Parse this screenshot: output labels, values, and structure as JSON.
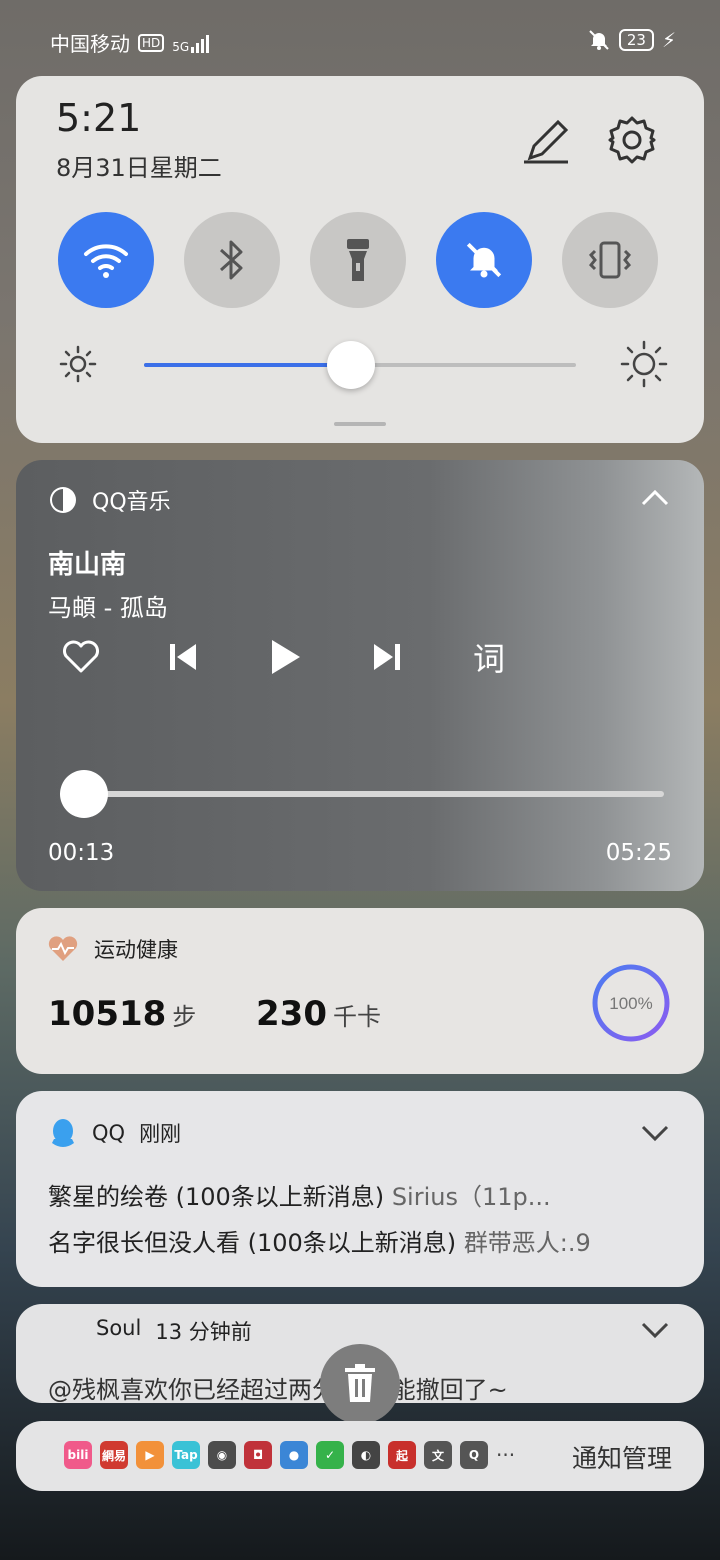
{
  "status_bar": {
    "carrier": "中国移动",
    "hd": "HD",
    "network": "5G",
    "battery": "23"
  },
  "quick_settings": {
    "time": "5:21",
    "date": "8月31日星期二",
    "toggles": [
      {
        "name": "wifi",
        "state": "on"
      },
      {
        "name": "bluetooth",
        "state": "off"
      },
      {
        "name": "flashlight",
        "state": "off"
      },
      {
        "name": "silent",
        "state": "on"
      },
      {
        "name": "vibrate",
        "state": "off"
      }
    ],
    "brightness_fraction": 0.48,
    "colors": {
      "accent": "#3b7af0"
    }
  },
  "music": {
    "app_name": "QQ音乐",
    "song_title": "南山南",
    "artist_line": "马頔 - 孤岛",
    "lyrics_button": "词",
    "current_time": "00:13",
    "total_time": "05:25",
    "progress_fraction": 0.04
  },
  "health": {
    "app_name": "运动健康",
    "steps": "10518",
    "steps_unit": "步",
    "calories": "230",
    "calories_unit": "千卡",
    "goal_percent": "100%"
  },
  "qq_notification": {
    "app_name": "QQ",
    "time": "刚刚",
    "messages": [
      {
        "who": "繁星的绘卷 (100条以上新消息)",
        "text": "Sirius（11p..."
      },
      {
        "who": "名字很长但没人看 (100条以上新消息)",
        "text": "群带恶人:.9"
      }
    ]
  },
  "soul_notification": {
    "app_name": "Soul",
    "time": "13 分钟前",
    "preview": "@残枫喜欢你已经超过两分钟 不能撤回了~"
  },
  "bottom_bar": {
    "app_icons": [
      {
        "name": "bilibili-icon",
        "label": "bili",
        "color": "#f05a8a"
      },
      {
        "name": "netease-icon",
        "label": "網易",
        "color": "#d03a30"
      },
      {
        "name": "video-icon",
        "label": "▶",
        "color": "#f2913a"
      },
      {
        "name": "taptap-icon",
        "label": "Tap",
        "color": "#3ac2d6"
      },
      {
        "name": "wechat-icon",
        "label": "◉",
        "color": "#4c4c4c"
      },
      {
        "name": "shop-icon",
        "label": "◘",
        "color": "#c0323a"
      },
      {
        "name": "message-icon",
        "label": "●",
        "color": "#3b86d6"
      },
      {
        "name": "shield-icon",
        "label": "✓",
        "color": "#35b24a"
      },
      {
        "name": "qqmusic-icon",
        "label": "◐",
        "color": "#444444"
      },
      {
        "name": "qidian-icon",
        "label": "起",
        "color": "#c8302c"
      },
      {
        "name": "translate-icon",
        "label": "文",
        "color": "#555555"
      },
      {
        "name": "search-app-icon",
        "label": "Q",
        "color": "#555555"
      }
    ],
    "more": "···",
    "manage_label": "通知管理"
  }
}
